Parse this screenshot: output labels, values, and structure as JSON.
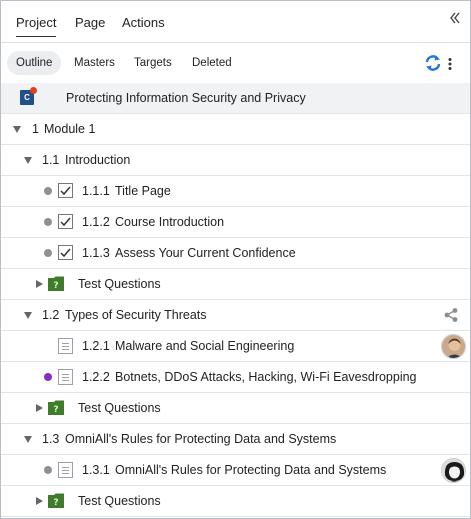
{
  "top_tabs": {
    "project": "Project",
    "page": "Page",
    "actions": "Actions"
  },
  "sub_tabs": {
    "outline": "Outline",
    "masters": "Masters",
    "targets": "Targets",
    "deleted": "Deleted"
  },
  "icons": {
    "collapse": "double-chevron-left-icon",
    "sync": "sync-icon",
    "menu": "kebab-menu-icon",
    "course": "course-icon",
    "share": "share-icon"
  },
  "colors": {
    "sync_blue": "#2a73d9",
    "status_purple": "#8a2bc7",
    "status_gray": "#8e9196",
    "course_badge": "#1f4f8a",
    "badge_dot": "#e2401b",
    "question_green": "#3f7d2c"
  },
  "course": {
    "badge_letter": "C",
    "title": "Protecting Information Security and Privacy"
  },
  "module": {
    "number": "1",
    "title": "Module 1"
  },
  "sections": [
    {
      "number": "1.1",
      "title": "Introduction",
      "pages": [
        {
          "number": "1.1.1",
          "title": "Title Page"
        },
        {
          "number": "1.1.2",
          "title": "Course Introduction"
        },
        {
          "number": "1.1.3",
          "title": "Assess Your Current Confidence"
        }
      ],
      "questions_label": "Test Questions"
    },
    {
      "number": "1.2",
      "title": "Types of Security Threats",
      "pages": [
        {
          "number": "1.2.1",
          "title": "Malware and Social Engineering"
        },
        {
          "number": "1.2.2",
          "title": "Botnets, DDoS Attacks, Hacking, Wi-Fi Eavesdropping"
        }
      ],
      "questions_label": "Test Questions"
    },
    {
      "number": "1.3",
      "title": "OmniAll's Rules for Protecting Data and Systems",
      "pages": [
        {
          "number": "1.3.1",
          "title": "OmniAll's Rules for Protecting Data and Systems"
        }
      ],
      "questions_label": "Test Questions"
    }
  ]
}
